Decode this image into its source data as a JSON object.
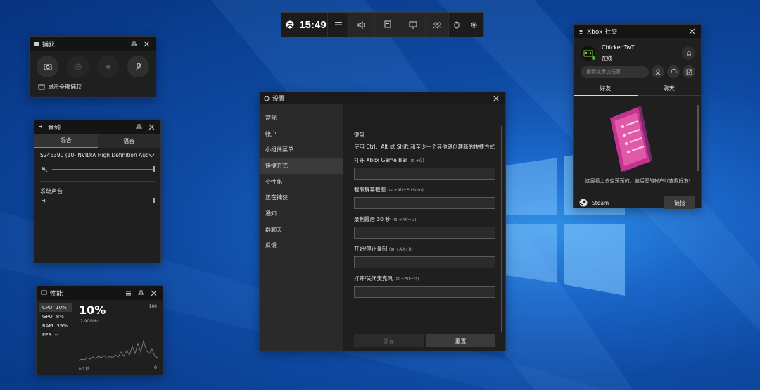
{
  "topbar": {
    "time": "15:49"
  },
  "capture": {
    "title": "捕获",
    "show_all": "显示全部捕获"
  },
  "audio": {
    "title": "音频",
    "tab_mix": "混合",
    "tab_voice": "语音",
    "device": "S24E390 (10- NVIDIA High Definition Aud...",
    "system_sound": "系统声音"
  },
  "perf": {
    "title": "性能",
    "metrics": [
      {
        "name": "CPU",
        "value": "10%"
      },
      {
        "name": "GPU",
        "value": "8%"
      },
      {
        "name": "RAM",
        "value": "39%"
      },
      {
        "name": "FPS",
        "value": "--"
      }
    ],
    "big_value": "10%",
    "freq": "2.90GHz",
    "max": "100",
    "time_label": "60 秒",
    "min": "0"
  },
  "settings": {
    "title": "设置",
    "nav": [
      "常规",
      "帐户",
      "小组件菜单",
      "快捷方式",
      "个性化",
      "正在捕获",
      "通知",
      "群聊天",
      "反馈"
    ],
    "selected": 3,
    "section": "键盘",
    "desc": "使用 Ctrl、Alt 或 Shift 和至少一个其他键创建新的快捷方式",
    "shortcuts": [
      {
        "label": "打开 Xbox Game Bar",
        "hint": "(⊞ +G)"
      },
      {
        "label": "截取屏幕截图",
        "hint": "(⊞ +Alt+PrtScrn)"
      },
      {
        "label": "录制最后 30 秒",
        "hint": "(⊞ +Alt+G)"
      },
      {
        "label": "开始/停止录制",
        "hint": "(⊞ +Alt+R)"
      },
      {
        "label": "打开/关闭麦克风",
        "hint": "(⊞ +Alt+M)"
      }
    ],
    "save": "保存",
    "reset": "重置"
  },
  "social": {
    "title": "Xbox 社交",
    "user": "ChickenTwT",
    "status": "在线",
    "search_placeholder": "搜索或添加玩家",
    "tab_friends": "好友",
    "tab_chat": "聊天",
    "message": "这里看上去空荡荡的。链接您的帐户以查找好友!",
    "steam": "Steam",
    "link": "链接"
  },
  "colors": {
    "accent_green": "#107c10",
    "online": "#3fbf3f",
    "poster": "#c2348f"
  }
}
